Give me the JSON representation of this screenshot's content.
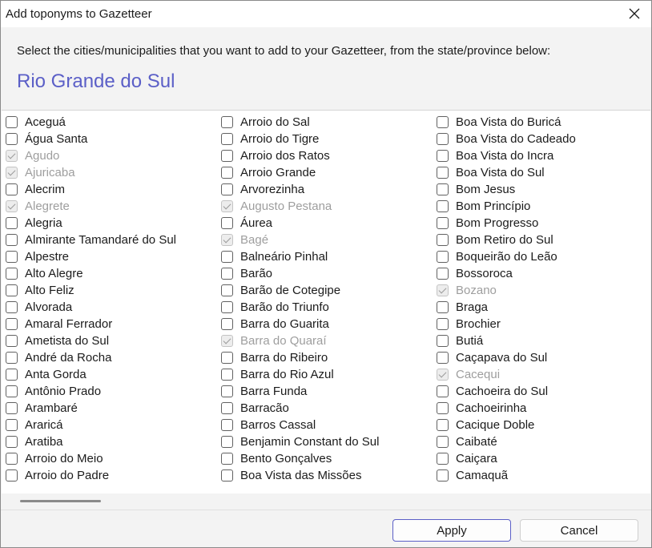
{
  "window": {
    "title": "Add toponyms to Gazetteer"
  },
  "header": {
    "instruction": "Select the cities/municipalities that you want to add to your Gazetteer, from the state/province below:",
    "state": "Rio Grande do Sul"
  },
  "columns": [
    [
      {
        "label": "Aceguá",
        "checked": false,
        "disabled": false
      },
      {
        "label": "Água Santa",
        "checked": false,
        "disabled": false
      },
      {
        "label": "Agudo",
        "checked": true,
        "disabled": true
      },
      {
        "label": "Ajuricaba",
        "checked": true,
        "disabled": true
      },
      {
        "label": "Alecrim",
        "checked": false,
        "disabled": false
      },
      {
        "label": "Alegrete",
        "checked": true,
        "disabled": true
      },
      {
        "label": "Alegria",
        "checked": false,
        "disabled": false
      },
      {
        "label": "Almirante Tamandaré do Sul",
        "checked": false,
        "disabled": false
      },
      {
        "label": "Alpestre",
        "checked": false,
        "disabled": false
      },
      {
        "label": "Alto Alegre",
        "checked": false,
        "disabled": false
      },
      {
        "label": "Alto Feliz",
        "checked": false,
        "disabled": false
      },
      {
        "label": "Alvorada",
        "checked": false,
        "disabled": false
      },
      {
        "label": "Amaral Ferrador",
        "checked": false,
        "disabled": false
      },
      {
        "label": "Ametista do Sul",
        "checked": false,
        "disabled": false
      },
      {
        "label": "André da Rocha",
        "checked": false,
        "disabled": false
      },
      {
        "label": "Anta Gorda",
        "checked": false,
        "disabled": false
      },
      {
        "label": "Antônio Prado",
        "checked": false,
        "disabled": false
      },
      {
        "label": "Arambaré",
        "checked": false,
        "disabled": false
      },
      {
        "label": "Araricá",
        "checked": false,
        "disabled": false
      },
      {
        "label": "Aratiba",
        "checked": false,
        "disabled": false
      },
      {
        "label": "Arroio do Meio",
        "checked": false,
        "disabled": false
      },
      {
        "label": "Arroio do Padre",
        "checked": false,
        "disabled": false
      }
    ],
    [
      {
        "label": "Arroio do Sal",
        "checked": false,
        "disabled": false
      },
      {
        "label": "Arroio do Tigre",
        "checked": false,
        "disabled": false
      },
      {
        "label": "Arroio dos Ratos",
        "checked": false,
        "disabled": false
      },
      {
        "label": "Arroio Grande",
        "checked": false,
        "disabled": false
      },
      {
        "label": "Arvorezinha",
        "checked": false,
        "disabled": false
      },
      {
        "label": "Augusto Pestana",
        "checked": true,
        "disabled": true
      },
      {
        "label": "Áurea",
        "checked": false,
        "disabled": false
      },
      {
        "label": "Bagé",
        "checked": true,
        "disabled": true
      },
      {
        "label": "Balneário Pinhal",
        "checked": false,
        "disabled": false
      },
      {
        "label": "Barão",
        "checked": false,
        "disabled": false
      },
      {
        "label": "Barão de Cotegipe",
        "checked": false,
        "disabled": false
      },
      {
        "label": "Barão do Triunfo",
        "checked": false,
        "disabled": false
      },
      {
        "label": "Barra do Guarita",
        "checked": false,
        "disabled": false
      },
      {
        "label": "Barra do Quaraí",
        "checked": true,
        "disabled": true
      },
      {
        "label": "Barra do Ribeiro",
        "checked": false,
        "disabled": false
      },
      {
        "label": "Barra do Rio Azul",
        "checked": false,
        "disabled": false
      },
      {
        "label": "Barra Funda",
        "checked": false,
        "disabled": false
      },
      {
        "label": "Barracão",
        "checked": false,
        "disabled": false
      },
      {
        "label": "Barros Cassal",
        "checked": false,
        "disabled": false
      },
      {
        "label": "Benjamin Constant do Sul",
        "checked": false,
        "disabled": false
      },
      {
        "label": "Bento Gonçalves",
        "checked": false,
        "disabled": false
      },
      {
        "label": "Boa Vista das Missões",
        "checked": false,
        "disabled": false
      }
    ],
    [
      {
        "label": "Boa Vista do Buricá",
        "checked": false,
        "disabled": false
      },
      {
        "label": "Boa Vista do Cadeado",
        "checked": false,
        "disabled": false
      },
      {
        "label": "Boa Vista do Incra",
        "checked": false,
        "disabled": false
      },
      {
        "label": "Boa Vista do Sul",
        "checked": false,
        "disabled": false
      },
      {
        "label": "Bom Jesus",
        "checked": false,
        "disabled": false
      },
      {
        "label": "Bom Princípio",
        "checked": false,
        "disabled": false
      },
      {
        "label": "Bom Progresso",
        "checked": false,
        "disabled": false
      },
      {
        "label": "Bom Retiro do Sul",
        "checked": false,
        "disabled": false
      },
      {
        "label": "Boqueirão do Leão",
        "checked": false,
        "disabled": false
      },
      {
        "label": "Bossoroca",
        "checked": false,
        "disabled": false
      },
      {
        "label": "Bozano",
        "checked": true,
        "disabled": true
      },
      {
        "label": "Braga",
        "checked": false,
        "disabled": false
      },
      {
        "label": "Brochier",
        "checked": false,
        "disabled": false
      },
      {
        "label": "Butiá",
        "checked": false,
        "disabled": false
      },
      {
        "label": "Caçapava do Sul",
        "checked": false,
        "disabled": false
      },
      {
        "label": "Cacequi",
        "checked": true,
        "disabled": true
      },
      {
        "label": "Cachoeira do Sul",
        "checked": false,
        "disabled": false
      },
      {
        "label": "Cachoeirinha",
        "checked": false,
        "disabled": false
      },
      {
        "label": "Cacique Doble",
        "checked": false,
        "disabled": false
      },
      {
        "label": "Caibaté",
        "checked": false,
        "disabled": false
      },
      {
        "label": "Caiçara",
        "checked": false,
        "disabled": false
      },
      {
        "label": "Camaquã",
        "checked": false,
        "disabled": false
      }
    ]
  ],
  "footer": {
    "apply_label": "Apply",
    "cancel_label": "Cancel"
  },
  "icons": {
    "close": "close-icon",
    "checkbox": "checkbox",
    "checkmark": "checkmark-icon"
  },
  "colors": {
    "accent": "#5b5fc7",
    "disabled_text": "#9e9e9e"
  }
}
